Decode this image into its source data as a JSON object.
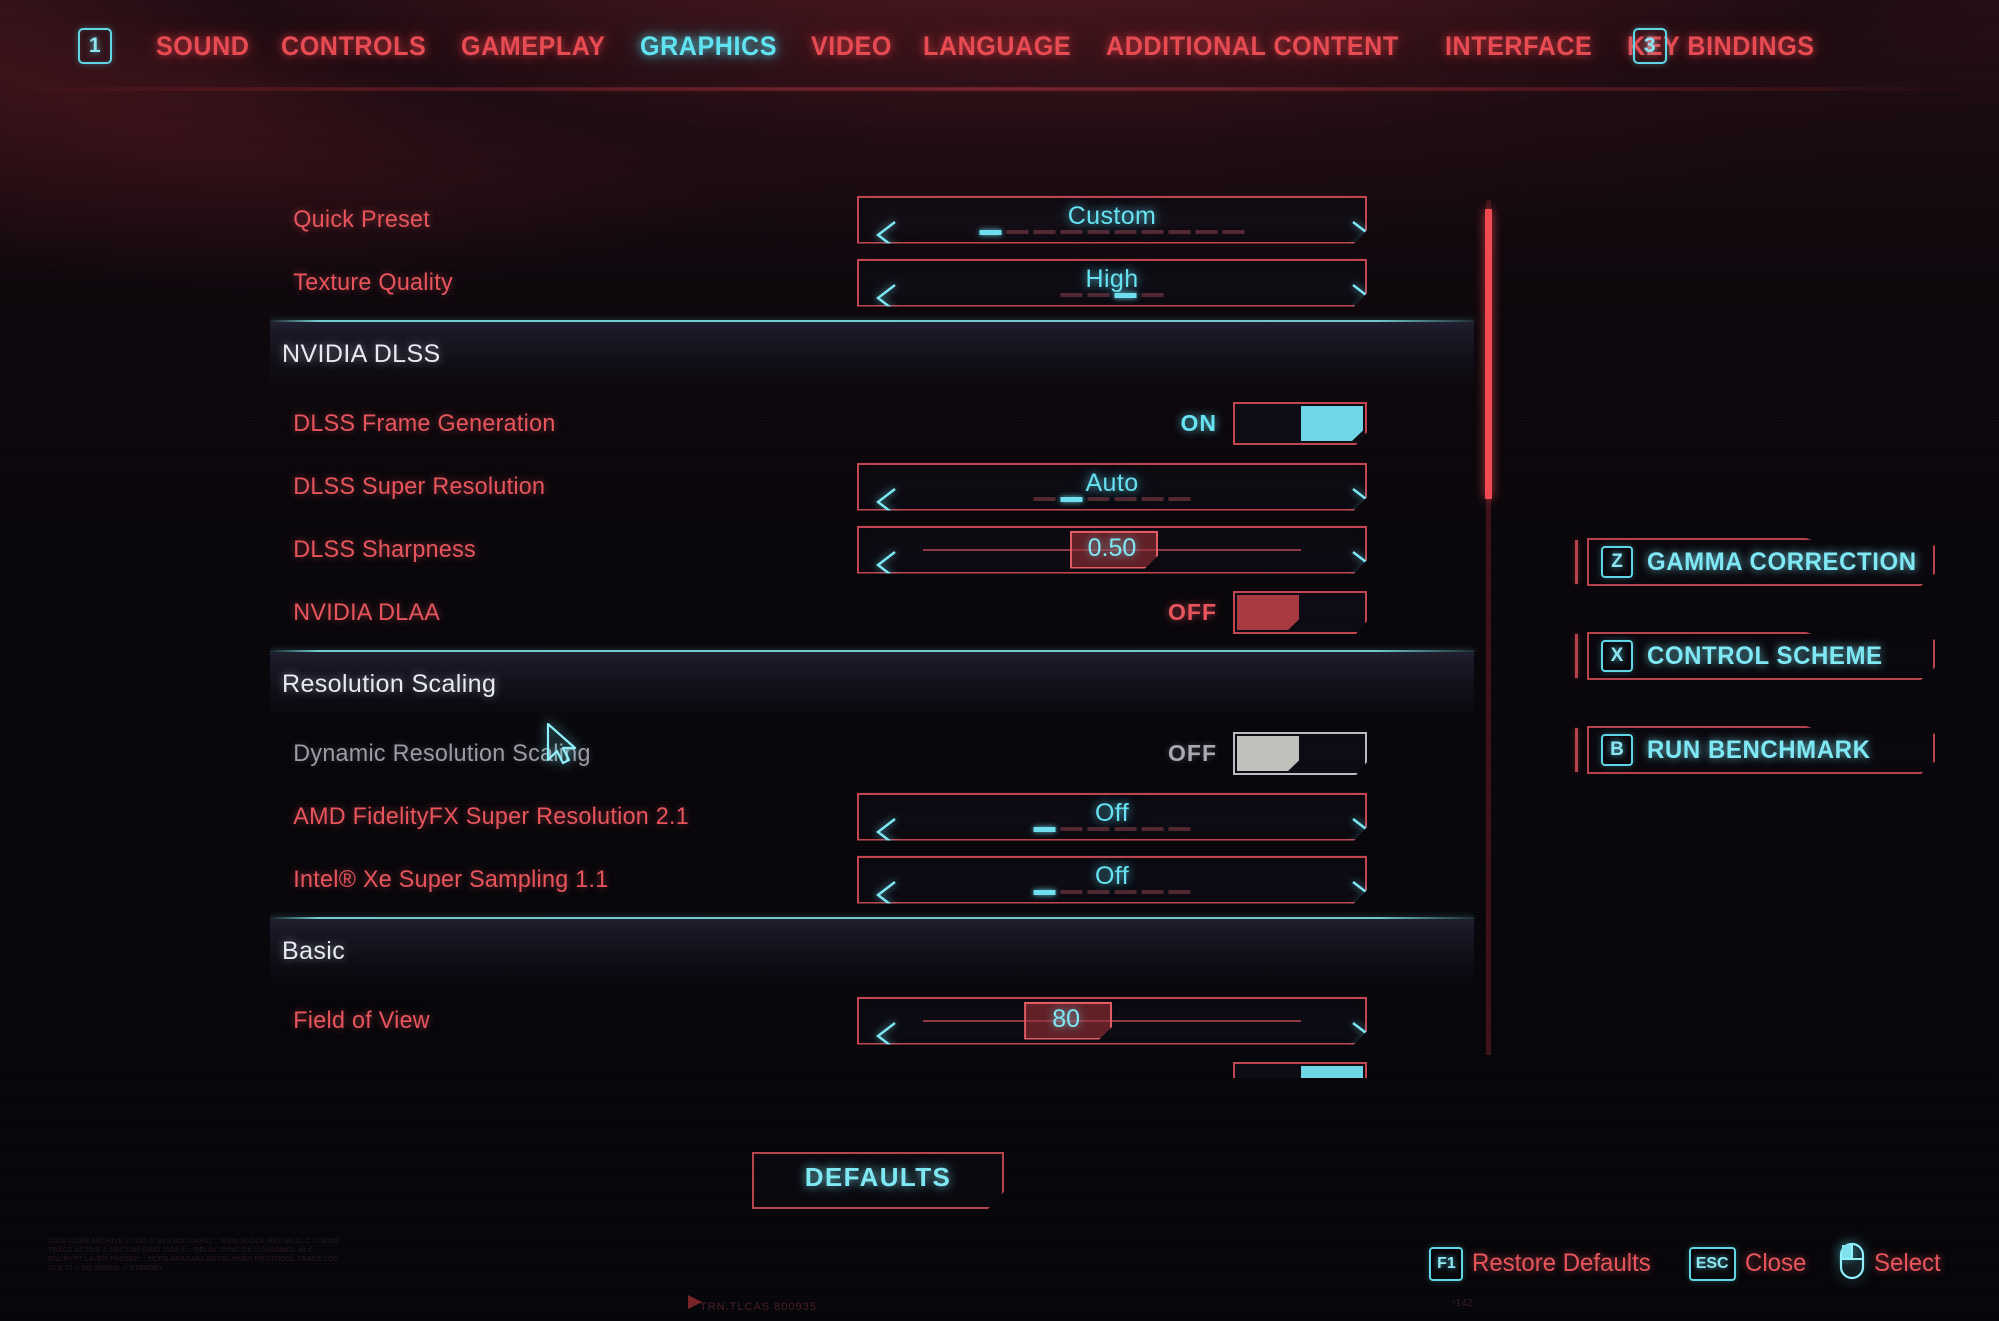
{
  "nav": {
    "left_key": "1",
    "right_key": "3",
    "items": [
      {
        "label": "SOUND",
        "active": false
      },
      {
        "label": "CONTROLS",
        "active": false
      },
      {
        "label": "GAMEPLAY",
        "active": false
      },
      {
        "label": "GRAPHICS",
        "active": true
      },
      {
        "label": "VIDEO",
        "active": false
      },
      {
        "label": "LANGUAGE",
        "active": false
      },
      {
        "label": "ADDITIONAL CONTENT",
        "active": false
      },
      {
        "label": "INTERFACE",
        "active": false
      },
      {
        "label": "KEY BINDINGS",
        "active": false
      }
    ]
  },
  "settings": {
    "quick_preset": {
      "label": "Quick Preset",
      "value": "Custom",
      "segments": 10,
      "active_segment": 1
    },
    "texture_quality": {
      "label": "Texture Quality",
      "value": "High",
      "segments": 4,
      "active_segment": 3
    },
    "section_dlss": {
      "title": "NVIDIA DLSS"
    },
    "dlss_frame_generation": {
      "label": "DLSS Frame Generation",
      "state": "ON"
    },
    "dlss_super_resolution": {
      "label": "DLSS Super Resolution",
      "value": "Auto",
      "segments": 6,
      "active_segment": 2
    },
    "dlss_sharpness": {
      "label": "DLSS Sharpness",
      "value": "0.50",
      "percent": 50
    },
    "nvidia_dlaa": {
      "label": "NVIDIA DLAA",
      "state": "OFF"
    },
    "section_resolution_scaling": {
      "title": "Resolution Scaling"
    },
    "dynamic_resolution_scaling": {
      "label": "Dynamic Resolution Scaling",
      "state": "OFF",
      "disabled": true
    },
    "amd_fsr": {
      "label": "AMD FidelityFX Super Resolution 2.1",
      "value": "Off",
      "segments": 6,
      "active_segment": 1
    },
    "intel_xess": {
      "label": "Intel® Xe Super Sampling 1.1",
      "value": "Off",
      "segments": 6,
      "active_segment": 1
    },
    "section_basic": {
      "title": "Basic"
    },
    "field_of_view": {
      "label": "Field of View",
      "value": "80",
      "percent": 38
    }
  },
  "actions": [
    {
      "key": "Z",
      "label": "GAMMA CORRECTION"
    },
    {
      "key": "X",
      "label": "CONTROL SCHEME"
    },
    {
      "key": "B",
      "label": "RUN BENCHMARK"
    }
  ],
  "defaults_button": {
    "label": "DEFAULTS"
  },
  "hints": [
    {
      "key": "F1",
      "label": "Restore Defaults",
      "icon": "key-icon"
    },
    {
      "key": "ESC",
      "label": "Close",
      "icon": "key-icon"
    },
    {
      "key": "",
      "label": "Select",
      "icon": "mouse-icon"
    }
  ],
  "scrollbar": {
    "thumb_top_percent": 1,
    "thumb_height_percent": 34
  },
  "colors": {
    "accent_red": "#e8545c",
    "accent_cyan": "#66e2f2",
    "border_red": "#c0454f",
    "toggle_on": "#6fd6e6",
    "toggle_off": "#a83940",
    "toggle_disabled": "#c2c0bb",
    "background": "#07060a"
  },
  "background_text": {
    "debris_1": "DATA CORE ARCHIVE v7.221 // SYS.IDX 0x4FA2 :: MEM-BLOCK REF 88-11-C // NODE TRACE ACTIVE // SECTOR GRID 1192-A :: RELAY SYNC OK // CHANNEL 44 // ENCRYPT LAYER PASSED :: NCPD ARASAKA NETRUNNER PROTOCOL TRACE LOG 22.8.77 // NO SIGNAL // STANDBY",
    "debris_2": "TRN.TLCAS 800935",
    "debris_3": "ⁿ142"
  }
}
